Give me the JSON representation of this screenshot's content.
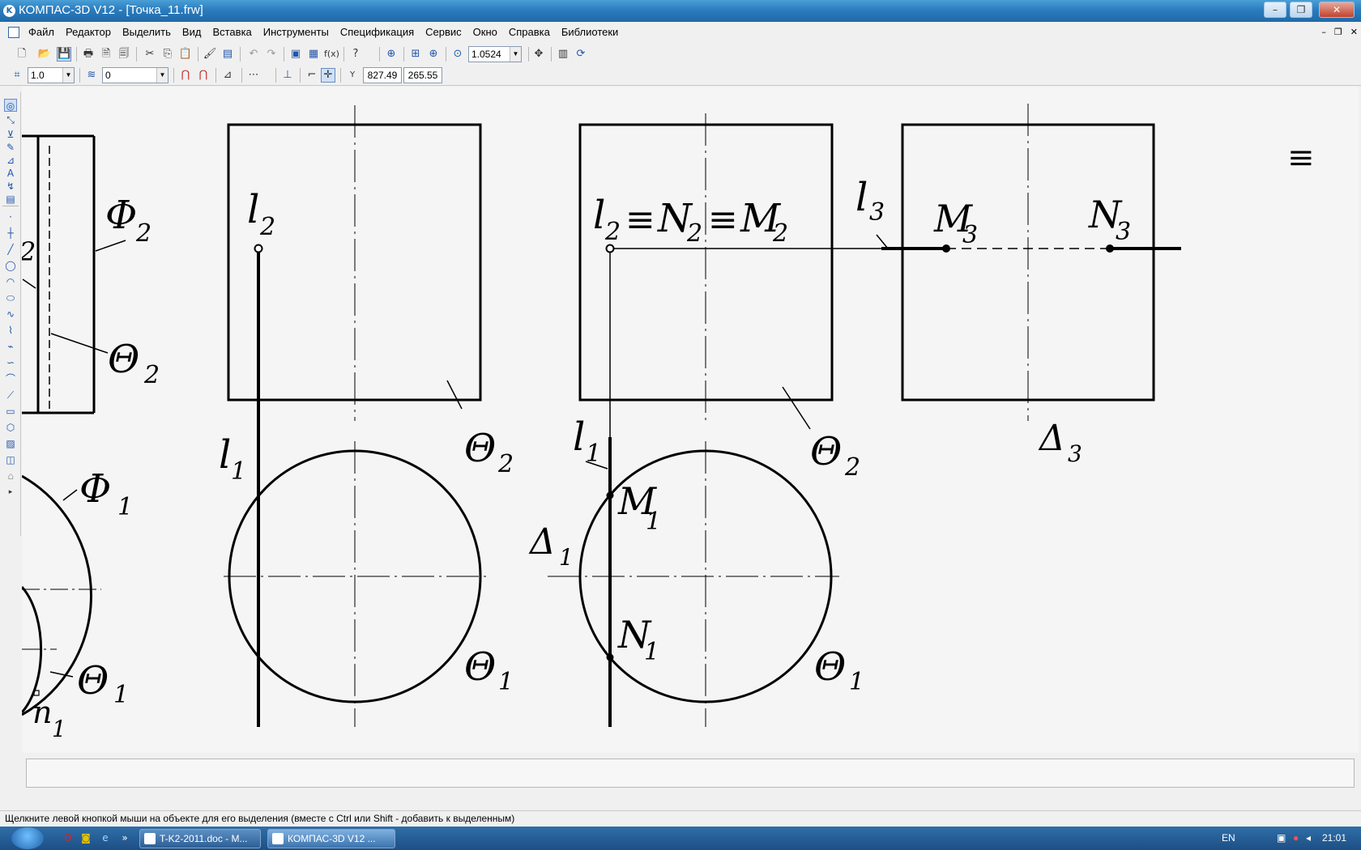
{
  "window": {
    "title": "КОМПАС-3D V12 - [Точка_11.frw]",
    "minimize": "–",
    "maximize": "❐",
    "close": "✕"
  },
  "menu": {
    "items": [
      "Файл",
      "Редактор",
      "Выделить",
      "Вид",
      "Вставка",
      "Инструменты",
      "Спецификация",
      "Сервис",
      "Окно",
      "Справка",
      "Библиотеки"
    ],
    "mdi_min": "–",
    "mdi_restore": "❐",
    "mdi_close": "✕"
  },
  "toolbar1": {
    "zoom_value": "1.0524"
  },
  "toolbar2": {
    "step_value": "1.0",
    "layer_value": "0",
    "coord_x": "827.49",
    "coord_y": "265.55"
  },
  "drawing": {
    "labels": {
      "phi2": "Φ",
      "phi2_sub": "2",
      "theta2_left": "Θ",
      "theta2_left_sub": "2",
      "frag2": "2",
      "phi1": "Φ",
      "phi1_sub": "1",
      "theta1_left": "Θ",
      "theta1_left_sub": "1",
      "pi1": "п",
      "pi1_sub": "1",
      "l2_a": "l",
      "l2_a_sub": "2",
      "theta2_a": "Θ",
      "theta2_a_sub": "2",
      "l1_a": "l",
      "l1_a_sub": "1",
      "theta1_a": "Θ",
      "theta1_a_sub": "1",
      "l2_b": "l",
      "l2_b_sub": "2",
      "equiv1": "≡",
      "n2": "N",
      "n2_sub": "2",
      "equiv2": "≡",
      "m2": "M",
      "m2_sub": "2",
      "theta2_b": "Θ",
      "theta2_b_sub": "2",
      "l1_b": "l",
      "l1_b_sub": "1",
      "m1": "M",
      "m1_sub": "1",
      "delta1": "Δ",
      "delta1_sub": "1",
      "n1": "N",
      "n1_sub": "1",
      "theta1_b": "Θ",
      "theta1_b_sub": "1",
      "l3": "l",
      "l3_sub": "3",
      "m3": "M",
      "m3_sub": "3",
      "n3": "N",
      "n3_sub": "3",
      "delta3": "Δ",
      "delta3_sub": "3",
      "equiv_top": "≡"
    }
  },
  "status": {
    "message": "Щелкните левой кнопкой мыши на объекте для его выделения (вместе с Ctrl или Shift - добавить к выделенным)"
  },
  "taskbar": {
    "tasks": [
      "T-K2-2011.doc - M...",
      "КОМПАС-3D V12 ..."
    ],
    "lang": "EN",
    "clock": "21:01",
    "more": "»"
  }
}
